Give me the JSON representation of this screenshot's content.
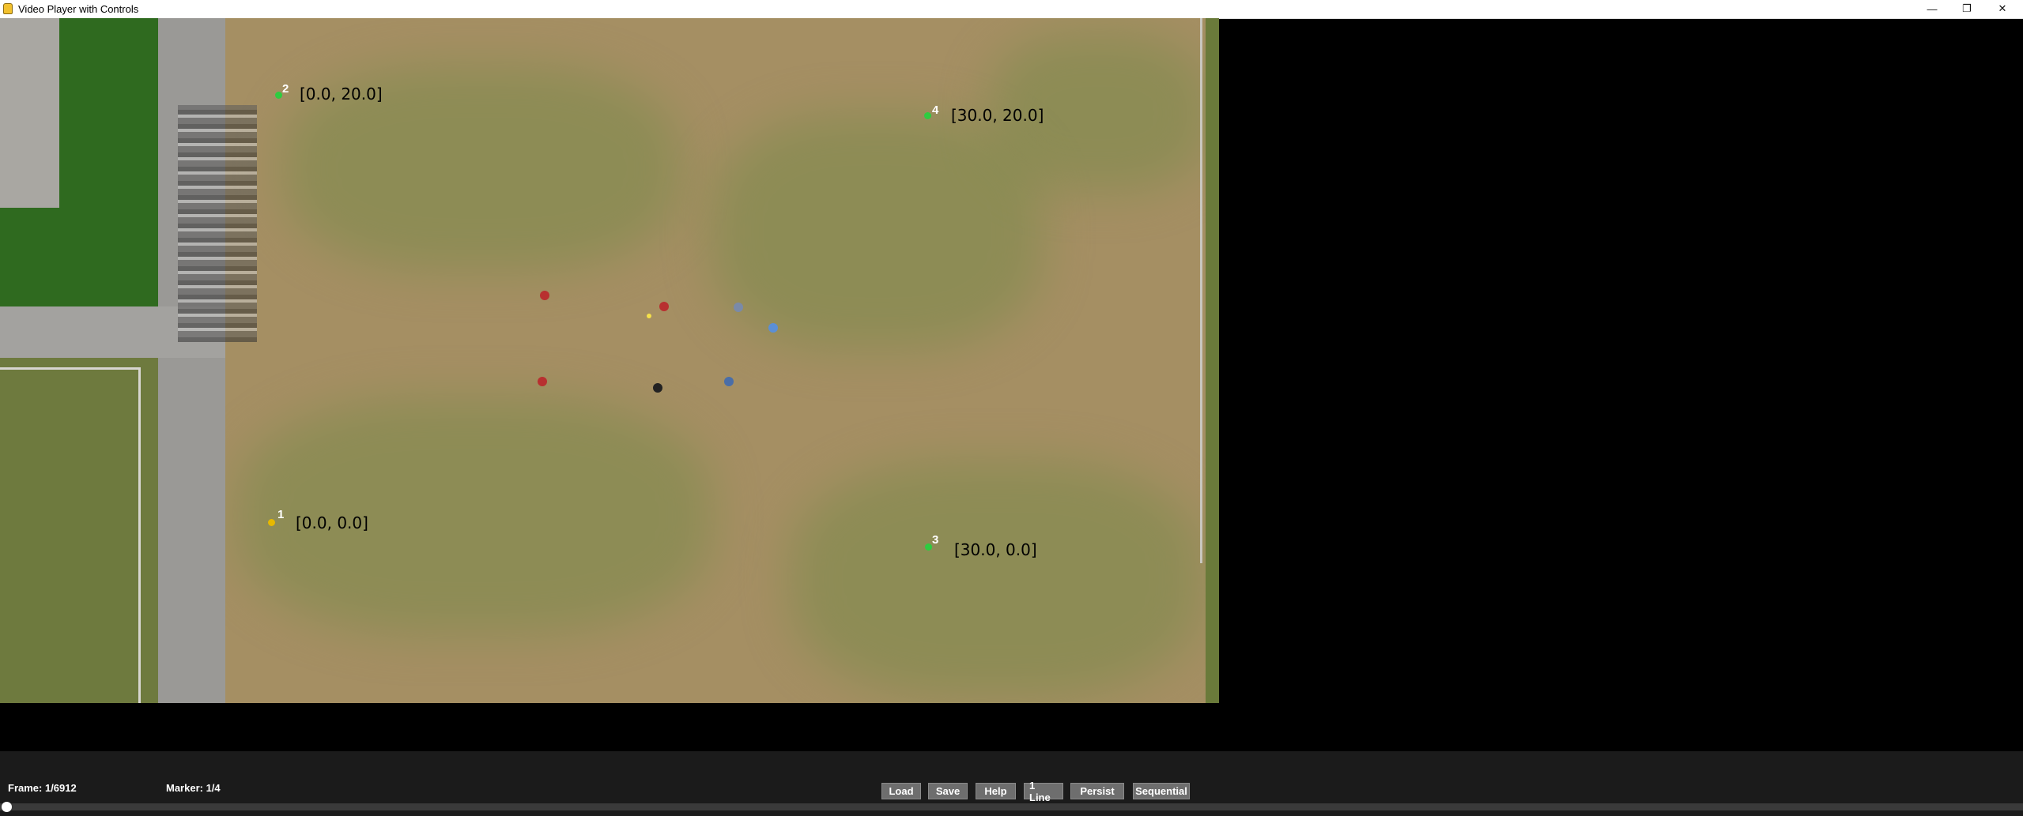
{
  "window": {
    "title": "Video Player with Controls",
    "icon": "python-icon",
    "controls": [
      "minimize-icon",
      "restore-icon",
      "close-icon"
    ],
    "control_glyphs": {
      "minimize": "—",
      "restore": "❐",
      "close": "✕"
    }
  },
  "markers": [
    {
      "num": "1",
      "coord": "[0.0, 0.0]",
      "color": "#e6b800"
    },
    {
      "num": "2",
      "coord": "[0.0, 20.0]",
      "color": "#2ecc40"
    },
    {
      "num": "3",
      "coord": "[30.0, 0.0]",
      "color": "#2ecc40"
    },
    {
      "num": "4",
      "coord": "[30.0, 20.0]",
      "color": "#2ecc40"
    }
  ],
  "status": {
    "frame": "Frame: 1/6912",
    "marker": "Marker: 1/4"
  },
  "buttons": {
    "load": "Load",
    "save": "Save",
    "help": "Help",
    "one_line": "1 Line",
    "persist": "Persist",
    "sequential": "Sequential"
  },
  "slider": {
    "position_fraction": 0.0
  }
}
